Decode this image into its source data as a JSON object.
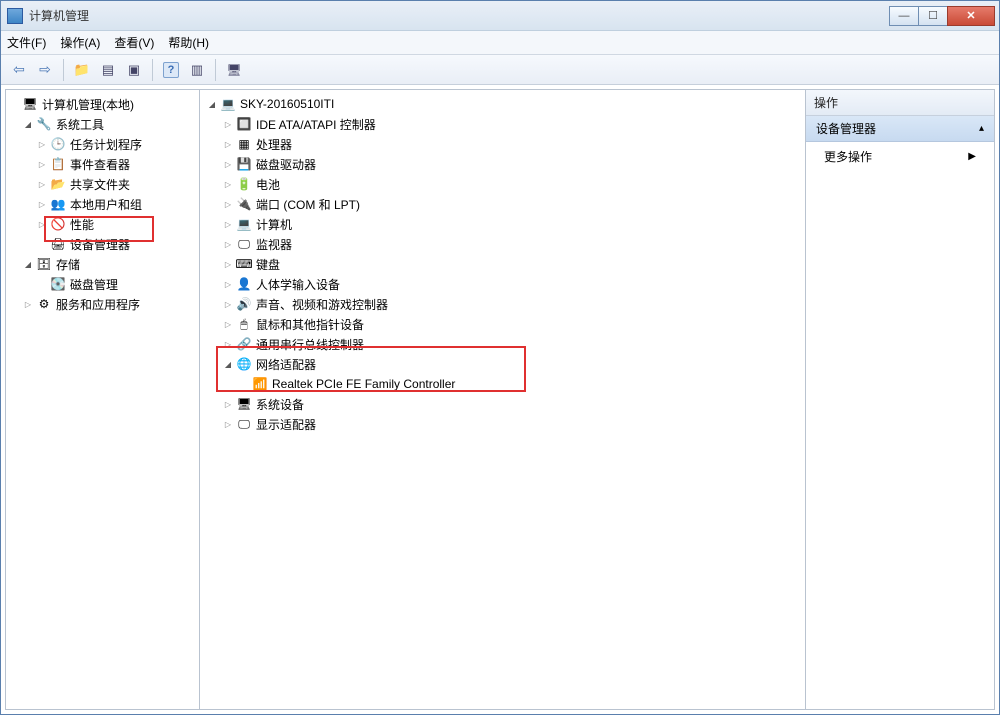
{
  "window": {
    "title": "计算机管理"
  },
  "menubar": {
    "file": "文件(F)",
    "action": "操作(A)",
    "view": "查看(V)",
    "help": "帮助(H)"
  },
  "left_tree": {
    "root": "计算机管理(本地)",
    "system_tools": "系统工具",
    "task_scheduler": "任务计划程序",
    "event_viewer": "事件查看器",
    "shared_folders": "共享文件夹",
    "local_users": "本地用户和组",
    "performance": "性能",
    "device_manager": "设备管理器",
    "storage": "存储",
    "disk_mgmt": "磁盘管理",
    "services_apps": "服务和应用程序"
  },
  "mid_tree": {
    "pc": "SKY-20160510ITI",
    "ide": "IDE ATA/ATAPI 控制器",
    "cpu": "处理器",
    "diskdrive": "磁盘驱动器",
    "battery": "电池",
    "ports": "端口 (COM 和 LPT)",
    "computer": "计算机",
    "monitor": "监视器",
    "keyboard": "键盘",
    "hid": "人体学输入设备",
    "sound": "声音、视频和游戏控制器",
    "mouse": "鼠标和其他指针设备",
    "usb": "通用串行总线控制器",
    "net": "网络适配器",
    "net_card": "Realtek PCIe FE Family Controller",
    "system_dev": "系统设备",
    "display": "显示适配器"
  },
  "right_pane": {
    "header": "操作",
    "section": "设备管理器",
    "more": "更多操作"
  }
}
